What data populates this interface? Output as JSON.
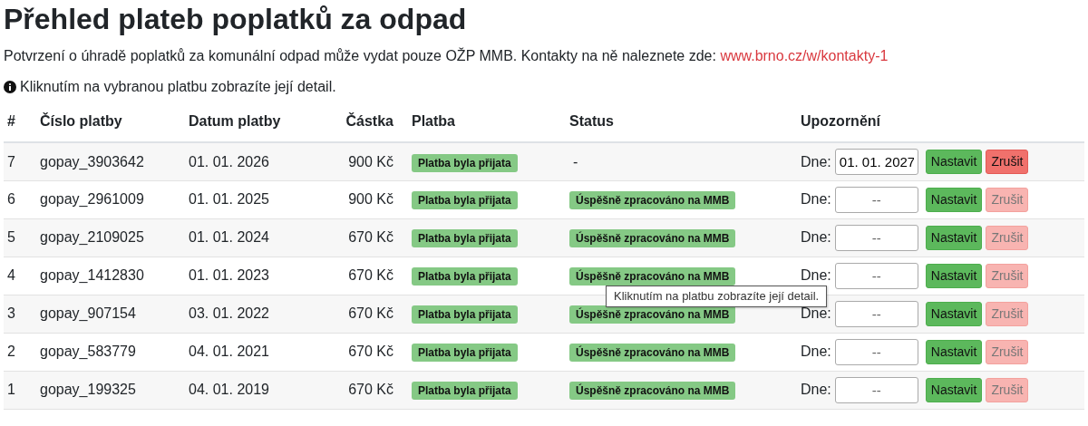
{
  "title": "Přehled plateb poplatků za odpad",
  "intro": {
    "text": "Potvrzení o úhradě poplatků za komunální odpad může vydat pouze OŽP MMB. Kontakty na ně naleznete zde:",
    "link": "www.brno.cz/w/kontakty-1"
  },
  "hint": "Kliknutím na vybranou platbu zobrazíte její detail.",
  "table": {
    "columns": [
      "#",
      "Číslo platby",
      "Datum platby",
      "Částka",
      "Platba",
      "Status",
      "Upozornění"
    ],
    "rows": [
      {
        "index": "7",
        "number": "gopay_3903642",
        "date": "01. 01. 2026",
        "amount": "900 Kč",
        "payment": "Platba byla přijata",
        "status": {
          "kind": "text",
          "text": "-"
        },
        "reminder": {
          "label": "Dne:",
          "value": "01. 01. 2027",
          "set": "Nastavit",
          "cancel": "Zrušit",
          "cancel_disabled": false
        }
      },
      {
        "index": "6",
        "number": "gopay_2961009",
        "date": "01. 01. 2025",
        "amount": "900 Kč",
        "payment": "Platba byla přijata",
        "status": {
          "kind": "badge",
          "text": "Úspěšně zpracováno na MMB"
        },
        "reminder": {
          "label": "Dne:",
          "placeholder": "--",
          "set": "Nastavit",
          "cancel": "Zrušit",
          "cancel_disabled": true
        }
      },
      {
        "index": "5",
        "number": "gopay_2109025",
        "date": "01. 01. 2024",
        "amount": "670 Kč",
        "payment": "Platba byla přijata",
        "status": {
          "kind": "badge",
          "text": "Úspěšně zpracováno na MMB"
        },
        "reminder": {
          "label": "Dne:",
          "placeholder": "--",
          "set": "Nastavit",
          "cancel": "Zrušit",
          "cancel_disabled": true
        }
      },
      {
        "index": "4",
        "number": "gopay_1412830",
        "date": "01. 01. 2023",
        "amount": "670 Kč",
        "payment": "Platba byla přijata",
        "status": {
          "kind": "badge",
          "text": "Úspěšně zpracováno na MMB"
        },
        "reminder": {
          "label": "Dne:",
          "placeholder": "--",
          "set": "Nastavit",
          "cancel": "Zrušit",
          "cancel_disabled": true
        }
      },
      {
        "index": "3",
        "number": "gopay_907154",
        "date": "03. 01. 2022",
        "amount": "670 Kč",
        "payment": "Platba byla přijata",
        "status": {
          "kind": "badge",
          "text": "Úspěšně zpracováno na MMB"
        },
        "reminder": {
          "label": "Dne:",
          "placeholder": "--",
          "set": "Nastavit",
          "cancel": "Zrušit",
          "cancel_disabled": true
        }
      },
      {
        "index": "2",
        "number": "gopay_583779",
        "date": "04. 01. 2021",
        "amount": "670 Kč",
        "payment": "Platba byla přijata",
        "status": {
          "kind": "badge",
          "text": "Úspěšně zpracováno na MMB"
        },
        "reminder": {
          "label": "Dne:",
          "placeholder": "--",
          "set": "Nastavit",
          "cancel": "Zrušit",
          "cancel_disabled": true
        }
      },
      {
        "index": "1",
        "number": "gopay_199325",
        "date": "04. 01. 2019",
        "amount": "670 Kč",
        "payment": "Platba byla přijata",
        "status": {
          "kind": "badge",
          "text": "Úspěšně zpracováno na MMB"
        },
        "reminder": {
          "label": "Dne:",
          "placeholder": "--",
          "set": "Nastavit",
          "cancel": "Zrušit",
          "cancel_disabled": true
        }
      }
    ]
  },
  "tooltip": "Kliknutím na platbu zobrazíte její detail."
}
